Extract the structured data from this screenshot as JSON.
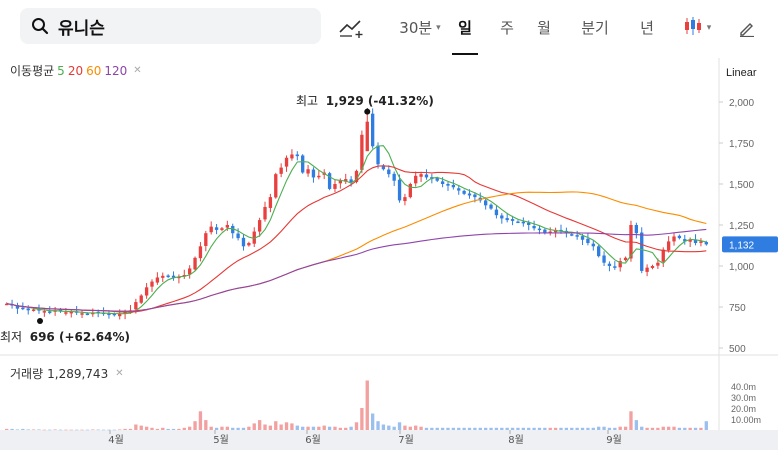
{
  "search": {
    "stock_name": "유니슨",
    "icon": "search-icon"
  },
  "toolbar": {
    "draw_icon": "trend-draw-icon",
    "period": "30분",
    "tabs": [
      "일",
      "주",
      "월",
      "분기",
      "년"
    ],
    "active_tab": "일",
    "candle_icon": "candlestick-icon",
    "edit_icon": "pencil-icon"
  },
  "ma_legend": {
    "label": "이동평균",
    "items": [
      {
        "text": "5",
        "color": "#4caf50"
      },
      {
        "text": "20",
        "color": "#e53935"
      },
      {
        "text": "60",
        "color": "#fb8c00"
      },
      {
        "text": "120",
        "color": "#8e44ad"
      }
    ]
  },
  "scale_label": "Linear",
  "current_price": "1,132",
  "high_marker": {
    "label": "최고",
    "value": "1,929 (-41.32%)"
  },
  "low_marker": {
    "label": "최저",
    "value": "696 (+62.64%)"
  },
  "volume_legend": {
    "label": "거래량",
    "value": "1,289,743"
  },
  "colors": {
    "up": "#e8403f",
    "down": "#2f7de1",
    "price_tag": "#2f7de1"
  },
  "chart_data": [
    {
      "type": "candlestick",
      "title": "",
      "x_labels": [
        "4월",
        "5월",
        "6월",
        "7월",
        "8월",
        "9월"
      ],
      "y_ticks": [
        "2,000",
        "1,750",
        "1,500",
        "1,250",
        "1,000",
        "750",
        "500"
      ],
      "ylim": [
        500,
        2000
      ],
      "close": [
        770,
        760,
        740,
        745,
        730,
        735,
        728,
        725,
        720,
        730,
        722,
        718,
        720,
        715,
        712,
        708,
        715,
        720,
        710,
        705,
        700,
        710,
        720,
        730,
        780,
        820,
        870,
        905,
        930,
        940,
        935,
        930,
        935,
        945,
        985,
        1050,
        1120,
        1200,
        1240,
        1220,
        1230,
        1250,
        1200,
        1170,
        1120,
        1140,
        1210,
        1280,
        1360,
        1420,
        1560,
        1600,
        1660,
        1680,
        1670,
        1570,
        1590,
        1540,
        1550,
        1570,
        1470,
        1500,
        1520,
        1530,
        1510,
        1580,
        1800,
        1929,
        1730,
        1620,
        1590,
        1560,
        1520,
        1400,
        1420,
        1500,
        1550,
        1560,
        1540,
        1530,
        1520,
        1500,
        1490,
        1480,
        1460,
        1440,
        1430,
        1420,
        1400,
        1370,
        1350,
        1310,
        1290,
        1280,
        1275,
        1270,
        1260,
        1250,
        1230,
        1220,
        1200,
        1210,
        1220,
        1210,
        1200,
        1190,
        1180,
        1160,
        1140,
        1120,
        1060,
        1020,
        1000,
        990,
        1030,
        1050,
        1250,
        1200,
        970,
        990,
        1000,
        1020,
        1100,
        1150,
        1180,
        1170,
        1150,
        1160,
        1140,
        1150,
        1132
      ],
      "ma": [
        {
          "period": "5",
          "color": "#4caf50"
        },
        {
          "period": "20",
          "color": "#e53935"
        },
        {
          "period": "60",
          "color": "#fb8c00"
        },
        {
          "period": "120",
          "color": "#8e44ad"
        }
      ]
    },
    {
      "type": "bar",
      "title": "",
      "ylabel": "",
      "y_ticks": [
        "40.0m",
        "30.0m",
        "20.0m",
        "10.00m"
      ],
      "ylim": [
        0,
        50
      ],
      "values": [
        1,
        1,
        0.5,
        1,
        0.5,
        0.5,
        0.5,
        0.3,
        0.3,
        0.5,
        0.3,
        0.3,
        0.3,
        0.3,
        0.3,
        0.3,
        0.5,
        0.4,
        0.3,
        0.3,
        0.3,
        0.5,
        1,
        1,
        5,
        4,
        3,
        2,
        1,
        2,
        1,
        1,
        1,
        2,
        3,
        8,
        17,
        9,
        3,
        2,
        3,
        3,
        2,
        2,
        2,
        3,
        6,
        9,
        5,
        4,
        8,
        5,
        7,
        6,
        4,
        3,
        3,
        3,
        3,
        4,
        3,
        3,
        2,
        2,
        3,
        7,
        20,
        45,
        15,
        8,
        5,
        4,
        3,
        7,
        4,
        3,
        4,
        3,
        2,
        2,
        2,
        2,
        2,
        2,
        2,
        2,
        2,
        2,
        2,
        2,
        2,
        2,
        2,
        2,
        2,
        2,
        2,
        2,
        2,
        2,
        2,
        2,
        2,
        2,
        2,
        2,
        2,
        2,
        2,
        2,
        3,
        3,
        2,
        2,
        3,
        3,
        17,
        9,
        3,
        2,
        2,
        2,
        3,
        3,
        3,
        2,
        2,
        2,
        2,
        2,
        8
      ]
    }
  ]
}
